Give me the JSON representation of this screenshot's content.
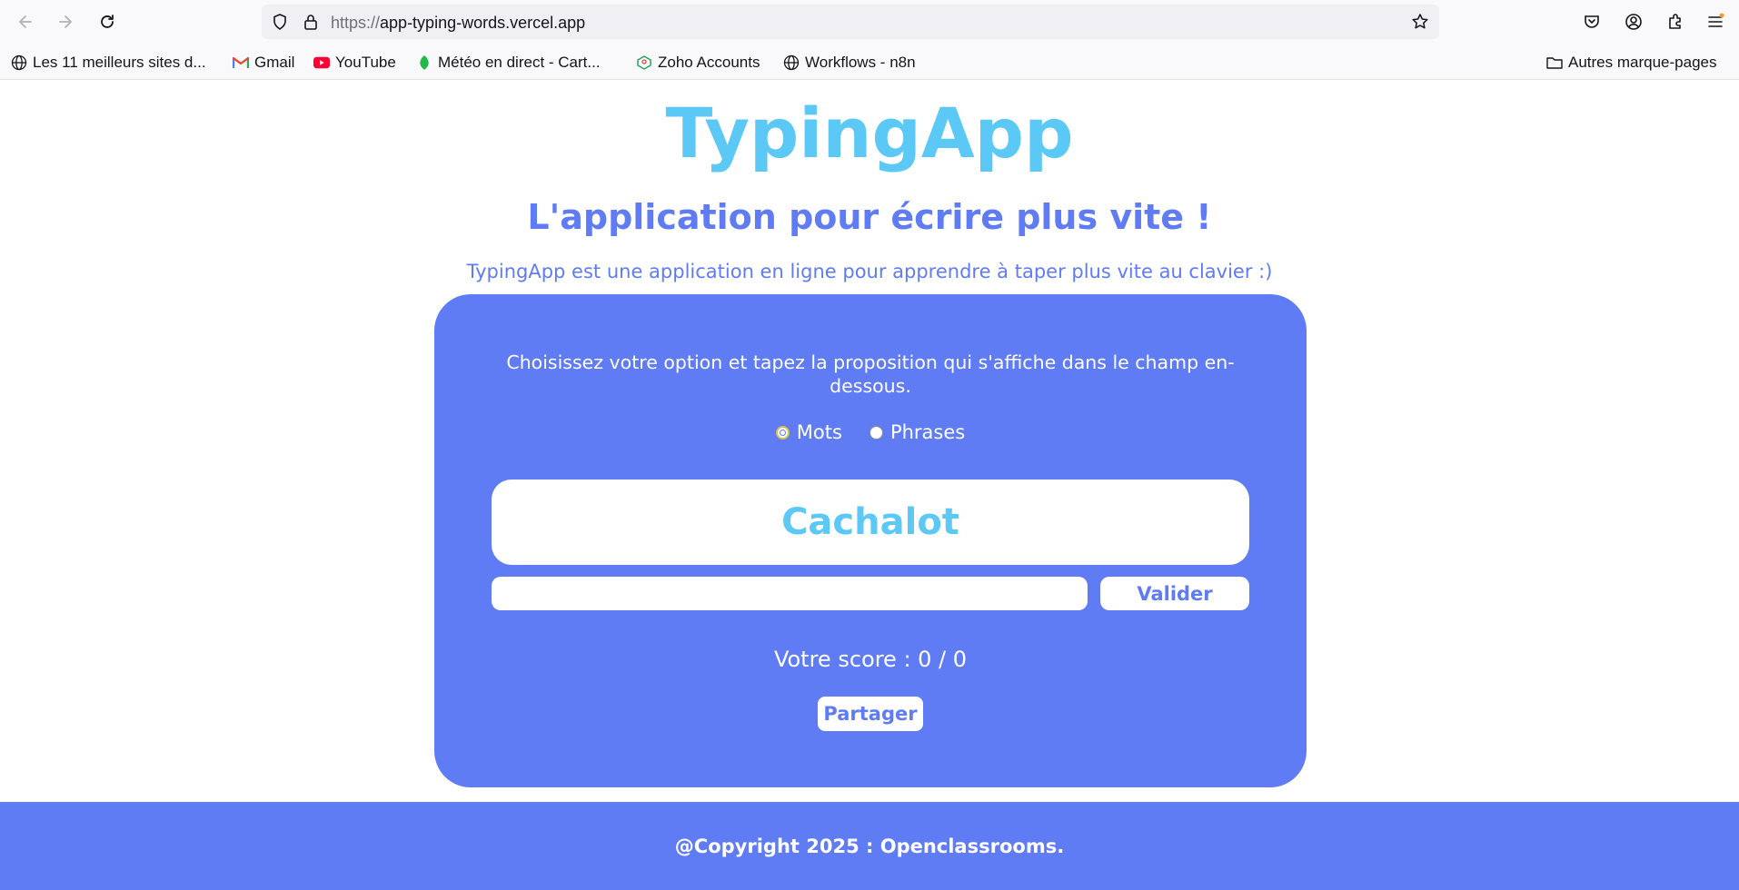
{
  "browser": {
    "url_scheme": "https://",
    "url_host": "app-typing-words.vercel.app",
    "bookmarks": [
      {
        "label": "Les 11 meilleurs sites d...",
        "icon": "globe-icon"
      },
      {
        "label": "Gmail",
        "icon": "gmail-icon"
      },
      {
        "label": "YouTube",
        "icon": "youtube-icon"
      },
      {
        "label": "Météo en direct - Cart...",
        "icon": "leaf-icon"
      },
      {
        "label": "Zoho Accounts",
        "icon": "zoho-icon"
      },
      {
        "label": "Workflows - n8n",
        "icon": "globe-icon"
      }
    ],
    "other_bookmarks": "Autres marque-pages"
  },
  "header": {
    "title": "TypingApp",
    "subtitle": "L'application pour écrire plus vite !",
    "description": "TypingApp est une application en ligne pour apprendre à taper plus vite au clavier :)"
  },
  "game": {
    "instruction": "Choisissez votre option et tapez la proposition qui s'affiche dans le champ en-dessous.",
    "options": [
      {
        "label": "Mots",
        "checked": true
      },
      {
        "label": "Phrases",
        "checked": false
      }
    ],
    "current_word": "Cachalot",
    "input_value": "",
    "validate_label": "Valider",
    "score_text": "Votre score : 0 / 0",
    "share_label": "Partager"
  },
  "footer": {
    "text": "@Copyright 2025 : Openclassrooms."
  },
  "colors": {
    "primary": "#5f7cf4",
    "accent": "#5bc8f5",
    "white": "#ffffff"
  }
}
